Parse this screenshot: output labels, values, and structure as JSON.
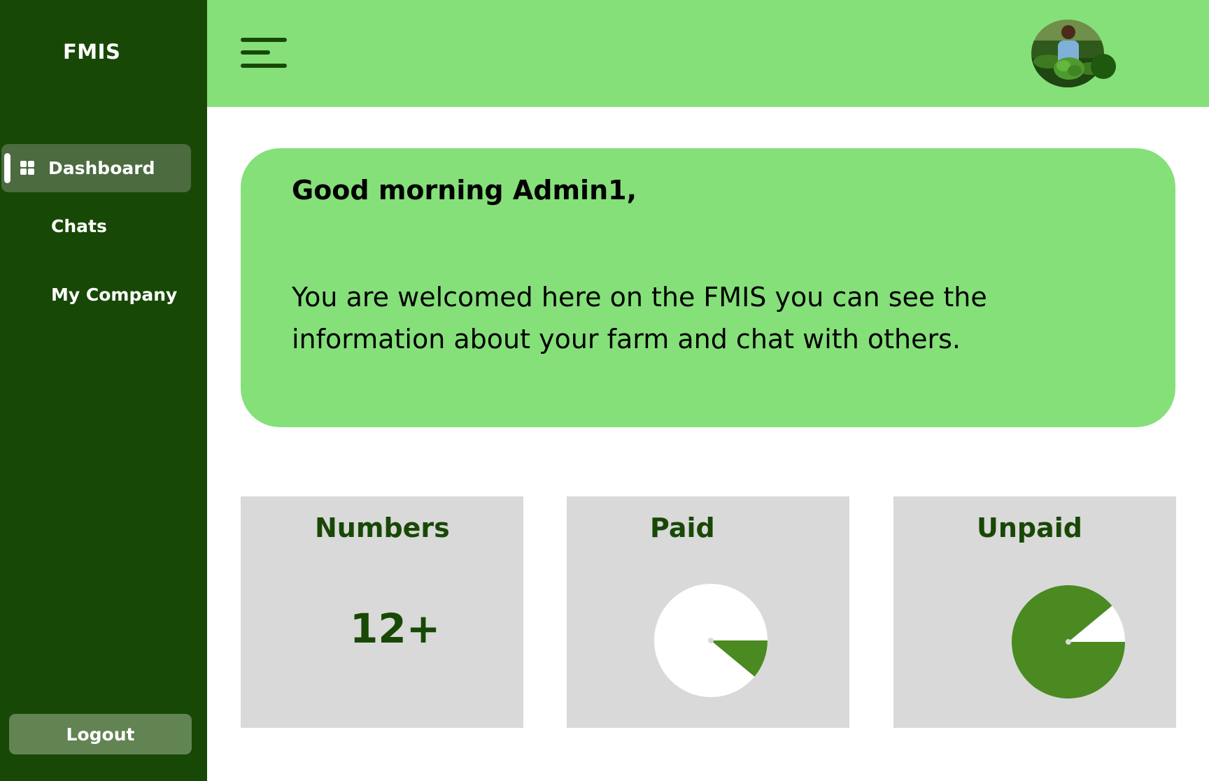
{
  "app": {
    "brand": "FMIS"
  },
  "sidebar": {
    "items": [
      {
        "label": "Dashboard",
        "icon": "grid-icon",
        "active": true
      },
      {
        "label": "Chats",
        "active": false
      },
      {
        "label": "My Company",
        "active": false
      }
    ],
    "logout_label": "Logout"
  },
  "header": {
    "menu_icon": "hamburger-icon",
    "avatar": "user-avatar",
    "status": "online"
  },
  "welcome": {
    "greeting": "Good morning Admin1,",
    "message": "You are welcomed here on the FMIS you can see the information about your farm and chat with others."
  },
  "stats": {
    "numbers": {
      "title": "Numbers",
      "value": "12+"
    },
    "paid": {
      "title": "Paid",
      "fraction": 0.11
    },
    "unpaid": {
      "title": "Unpaid",
      "fraction": 0.89
    }
  },
  "colors": {
    "sidebar": "#184806",
    "accent": "#85e07a",
    "pie_fill": "#4a8a21",
    "card": "#d9d9d9"
  }
}
